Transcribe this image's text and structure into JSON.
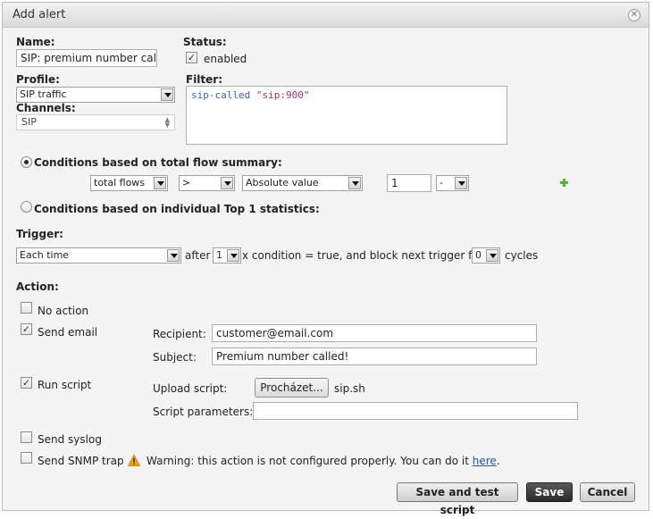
{
  "dialog": {
    "title": "Add alert"
  },
  "name": {
    "label": "Name:",
    "value": "SIP: premium number called"
  },
  "status": {
    "label": "Status:",
    "enabled_checked": true,
    "enabled_label": "enabled"
  },
  "profile": {
    "label": "Profile:",
    "value": "SIP traffic"
  },
  "channels": {
    "label": "Channels:",
    "value": "SIP"
  },
  "filter": {
    "label": "Filter:",
    "keyword": "sip-called",
    "string": "\"sip:900\""
  },
  "conditions": {
    "summary_label": "Conditions based on total flow summary:",
    "summary_selected": true,
    "metric": "total flows",
    "operator": ">",
    "value_type": "Absolute value",
    "threshold": "1",
    "unit": "-",
    "top_label": "Conditions based on individual Top 1 statistics:",
    "top_selected": false
  },
  "trigger": {
    "label": "Trigger:",
    "mode": "Each time",
    "after_text": "after",
    "count": "1",
    "middle_text": "x condition = true, and block next trigger for",
    "block_cycles": "0",
    "cycles_text": "cycles"
  },
  "action": {
    "label": "Action:",
    "no_action": {
      "label": "No action",
      "checked": false
    },
    "send_email": {
      "label": "Send email",
      "checked": true,
      "recipient_label": "Recipient:",
      "recipient": "customer@email.com",
      "subject_label": "Subject:",
      "subject": "Premium number called!"
    },
    "run_script": {
      "label": "Run script",
      "checked": true,
      "upload_label": "Upload script:",
      "browse_label": "Procházet...",
      "file_name": "sip.sh",
      "params_label": "Script parameters:",
      "params": ""
    },
    "send_syslog": {
      "label": "Send syslog",
      "checked": false
    },
    "send_snmp": {
      "label": "Send SNMP trap",
      "checked": false,
      "warning_text": "Warning: this action is not configured properly. You can do it",
      "warning_link": "here",
      "warning_end": "."
    }
  },
  "buttons": {
    "save_test": "Save and test script",
    "save": "Save",
    "cancel": "Cancel"
  },
  "colors": {
    "accent_plus": "#5ab228",
    "warning": "#f0a500",
    "link": "#2255aa"
  }
}
